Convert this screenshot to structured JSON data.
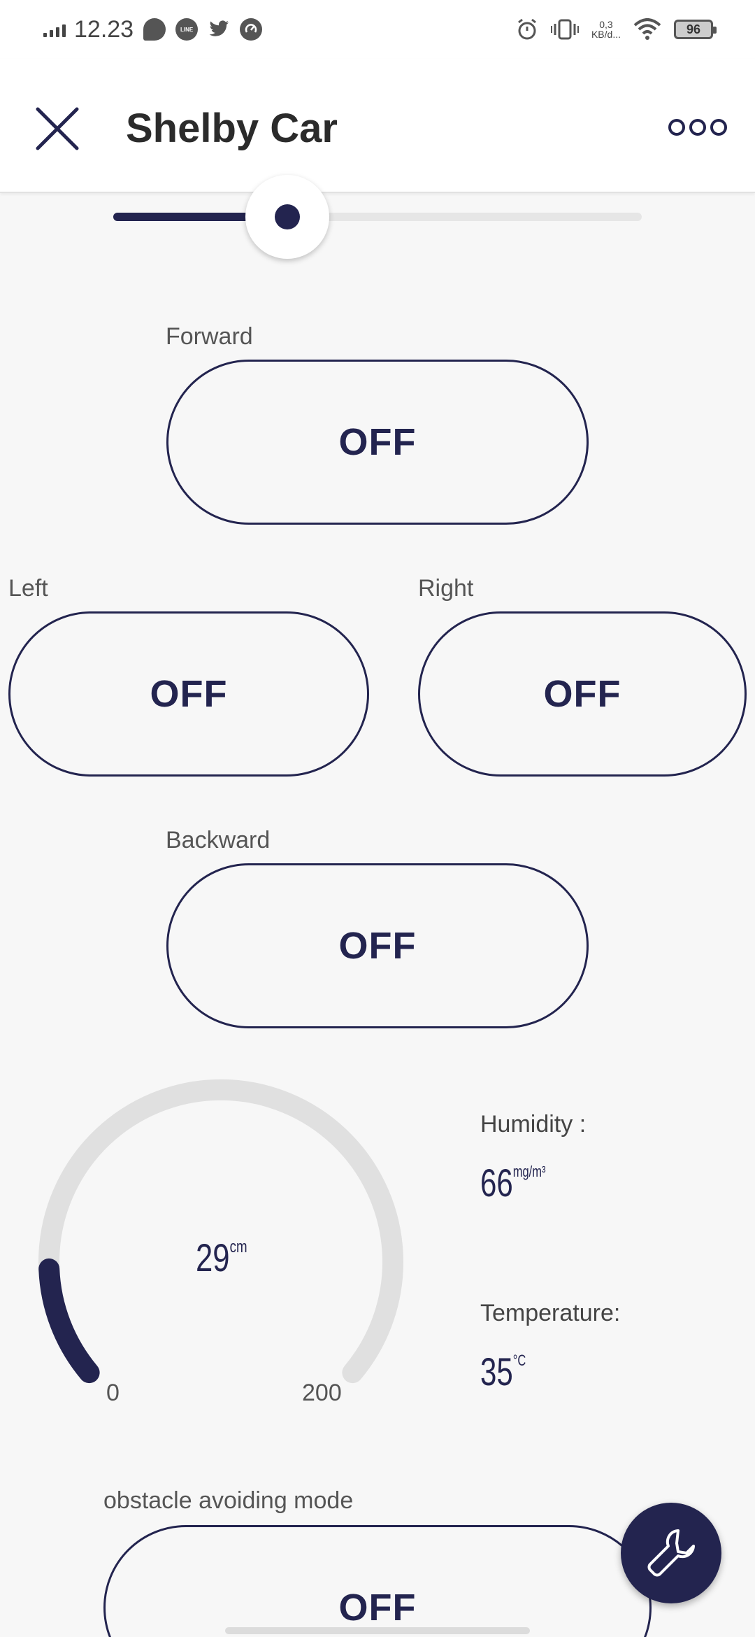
{
  "status_bar": {
    "time": "12.23",
    "network_speed_top": "0,3",
    "network_speed_bottom": "KB/d...",
    "battery": "96",
    "icons": [
      "signal-icon",
      "chat-icon",
      "line-icon",
      "twitter-icon",
      "speedometer-icon",
      "alarm-icon",
      "vibrate-icon",
      "wifi-icon",
      "battery-icon"
    ],
    "notification_line_label": "LINE"
  },
  "app_bar": {
    "title": "Shelby Car",
    "close_icon": "close-icon",
    "more_icon": "more-icon"
  },
  "slider": {
    "value_fraction": 0.33
  },
  "controls": {
    "forward": {
      "label": "Forward",
      "state": "OFF"
    },
    "left": {
      "label": "Left",
      "state": "OFF"
    },
    "right": {
      "label": "Right",
      "state": "OFF"
    },
    "backward": {
      "label": "Backward",
      "state": "OFF"
    },
    "obstacle": {
      "label": "obstacle avoiding mode",
      "state": "OFF"
    }
  },
  "gauge": {
    "value": "29",
    "unit": "cm",
    "min": "0",
    "max": "200",
    "fill_fraction": 0.145,
    "accent_color": "#23244f",
    "track_color": "#e0e0e0"
  },
  "humidity": {
    "label": "Humidity :",
    "value": "66",
    "unit": "mg/m³"
  },
  "temperature": {
    "label": "Temperature:",
    "value": "35",
    "unit": "°C"
  },
  "fab": {
    "icon": "wrench-icon"
  },
  "colors": {
    "accent": "#23244f",
    "background": "#f7f7f7"
  }
}
